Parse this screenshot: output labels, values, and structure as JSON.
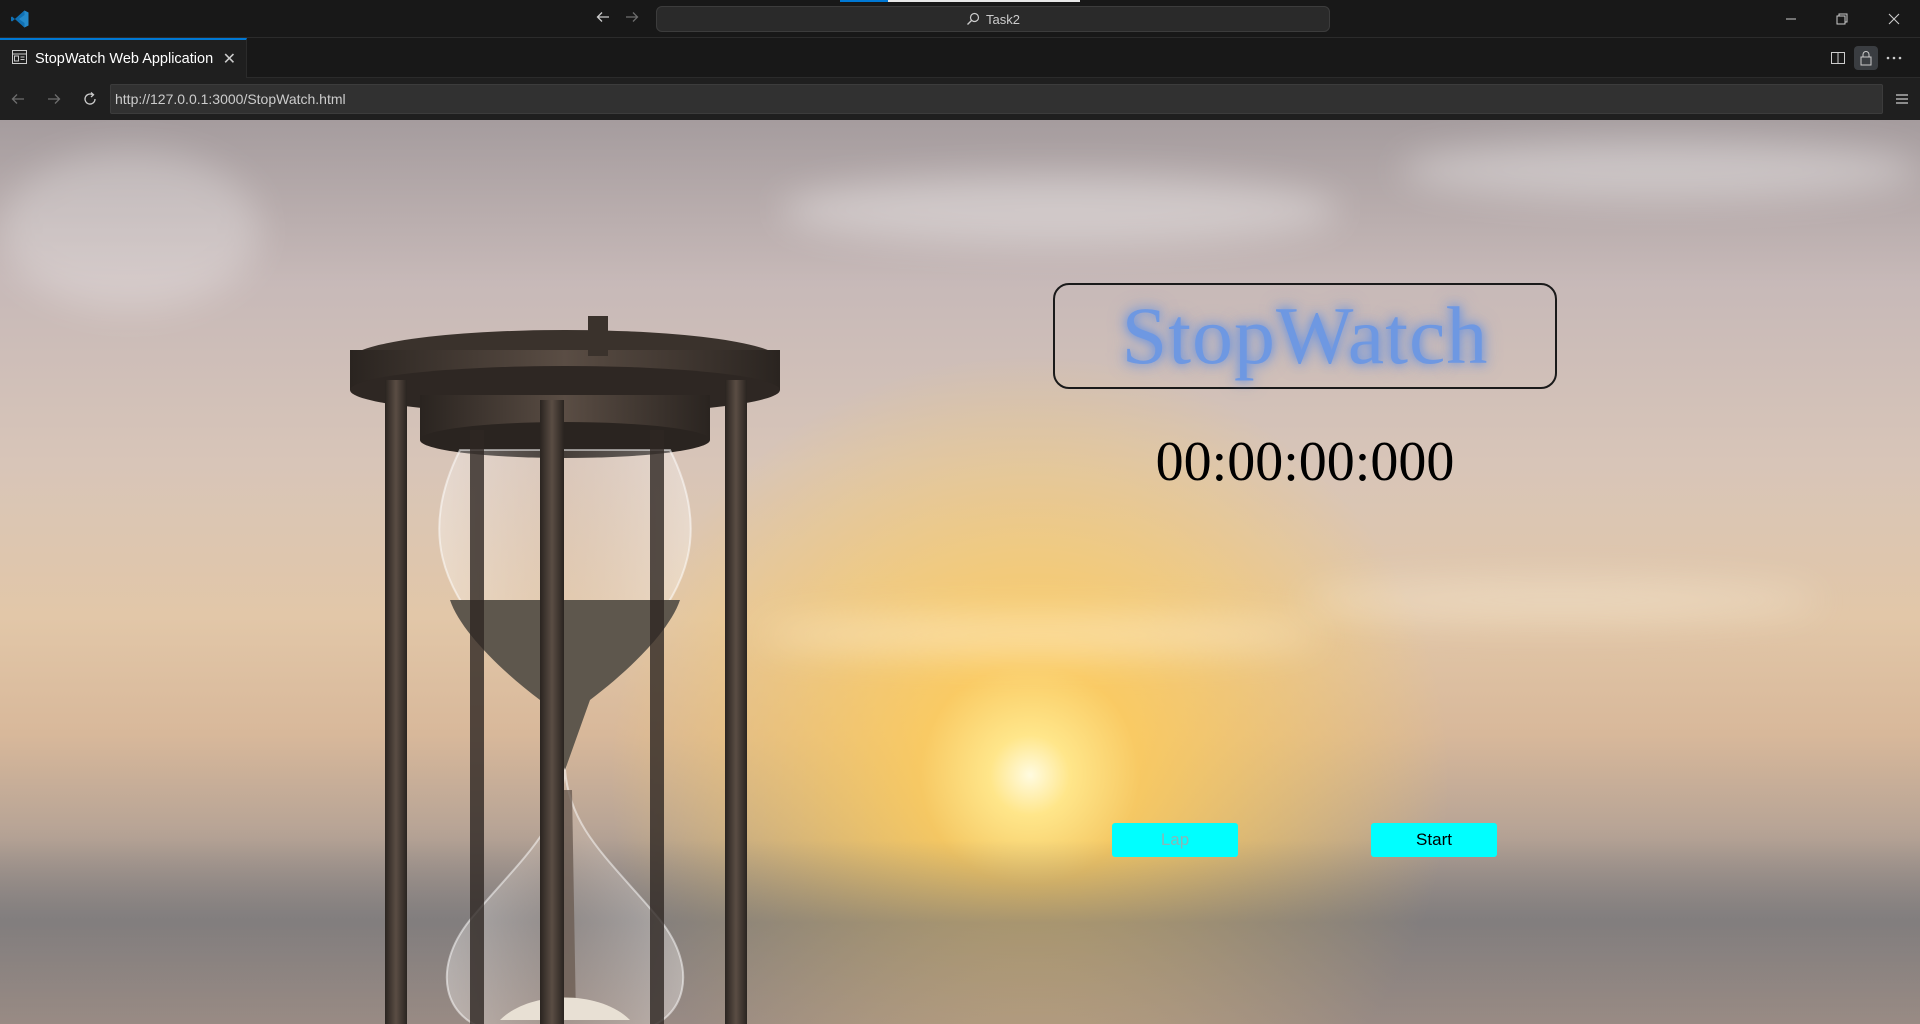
{
  "titlebar": {
    "search_text": "Task2"
  },
  "tab": {
    "title": "StopWatch Web Application",
    "close": "✕"
  },
  "address": {
    "url": "http://127.0.0.1:3000/StopWatch.html"
  },
  "page": {
    "title": "StopWatch",
    "time": "00:00:00:000",
    "lap_label": "Lap",
    "start_label": "Start"
  },
  "colors": {
    "accent": "#0078d4",
    "button": "#00ffff",
    "title_text": "#6e98e2"
  },
  "icons": {
    "app": "vscode-logo-icon",
    "back": "arrow-left-icon",
    "forward": "arrow-right-icon",
    "search": "search-icon",
    "minimize": "minimize-icon",
    "restore": "restore-icon",
    "close": "close-icon",
    "split": "split-editor-icon",
    "lock": "lock-icon",
    "more": "more-icon",
    "reload": "reload-icon",
    "menu": "menu-icon",
    "tab": "preview-icon"
  }
}
